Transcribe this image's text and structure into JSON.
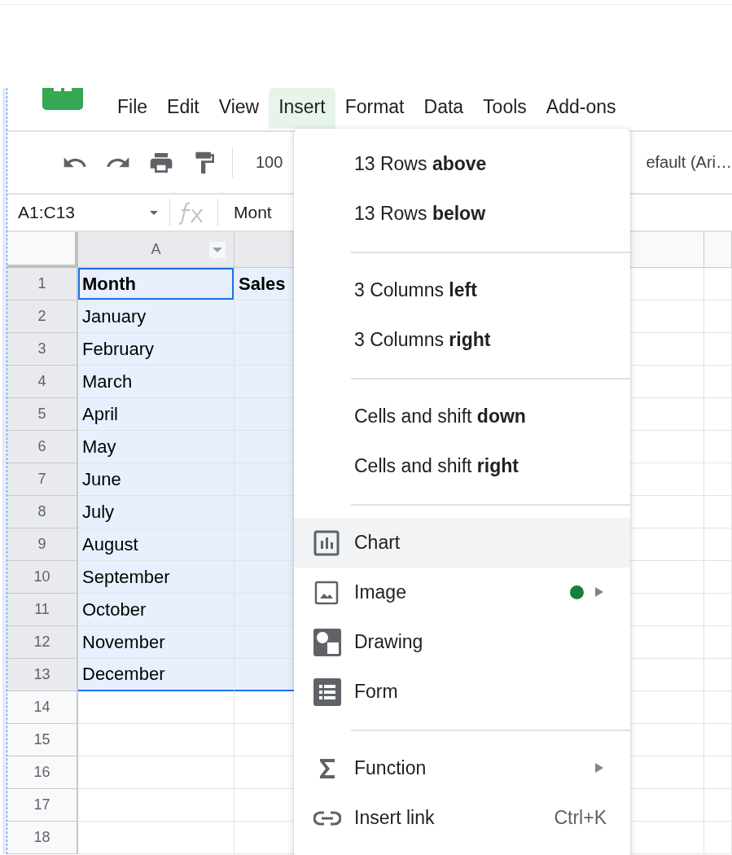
{
  "menu_bar": [
    {
      "label": "File",
      "selected": false
    },
    {
      "label": "Edit",
      "selected": false
    },
    {
      "label": "View",
      "selected": false
    },
    {
      "label": "Insert",
      "selected": true
    },
    {
      "label": "Format",
      "selected": false
    },
    {
      "label": "Data",
      "selected": false
    },
    {
      "label": "Tools",
      "selected": false
    },
    {
      "label": "Add-ons",
      "selected": false
    }
  ],
  "toolbar": {
    "zoom": "100",
    "font": "efault (Ari…"
  },
  "formula_bar": {
    "name_box": "A1:C13",
    "value": "Mont"
  },
  "column_header": "A",
  "rows": [
    {
      "number": "1",
      "selected": true,
      "bold": true,
      "cells": [
        "Month",
        "Sales"
      ]
    },
    {
      "number": "2",
      "selected": true,
      "bold": false,
      "cells": [
        "January"
      ]
    },
    {
      "number": "3",
      "selected": true,
      "bold": false,
      "cells": [
        "February"
      ]
    },
    {
      "number": "4",
      "selected": true,
      "bold": false,
      "cells": [
        "March"
      ]
    },
    {
      "number": "5",
      "selected": true,
      "bold": false,
      "cells": [
        "April"
      ]
    },
    {
      "number": "6",
      "selected": true,
      "bold": false,
      "cells": [
        "May"
      ]
    },
    {
      "number": "7",
      "selected": true,
      "bold": false,
      "cells": [
        "June"
      ]
    },
    {
      "number": "8",
      "selected": true,
      "bold": false,
      "cells": [
        "July"
      ]
    },
    {
      "number": "9",
      "selected": true,
      "bold": false,
      "cells": [
        "August"
      ]
    },
    {
      "number": "10",
      "selected": true,
      "bold": false,
      "cells": [
        "September"
      ]
    },
    {
      "number": "11",
      "selected": true,
      "bold": false,
      "cells": [
        "October"
      ]
    },
    {
      "number": "12",
      "selected": true,
      "bold": false,
      "cells": [
        "November"
      ]
    },
    {
      "number": "13",
      "selected": true,
      "bold": false,
      "cells": [
        "December"
      ]
    },
    {
      "number": "14",
      "selected": false,
      "cells": []
    },
    {
      "number": "15",
      "selected": false,
      "cells": []
    },
    {
      "number": "16",
      "selected": false,
      "cells": []
    },
    {
      "number": "17",
      "selected": false,
      "cells": []
    },
    {
      "number": "18",
      "selected": false,
      "cells": []
    }
  ],
  "insert_menu": [
    {
      "kind": "item",
      "label": "13 Rows **above**",
      "selected": false
    },
    {
      "kind": "item",
      "label": "13 Rows **below**",
      "selected": false
    },
    {
      "kind": "separator"
    },
    {
      "kind": "item",
      "label": "3 Columns **left**",
      "selected": false
    },
    {
      "kind": "item",
      "label": "3 Columns **right**",
      "selected": false
    },
    {
      "kind": "separator"
    },
    {
      "kind": "item",
      "label": "Cells and shift **down**",
      "selected": false
    },
    {
      "kind": "item",
      "label": "Cells and shift **right**",
      "selected": false
    },
    {
      "kind": "separator"
    },
    {
      "kind": "chart",
      "label": "Chart",
      "selected": true
    },
    {
      "kind": "image",
      "label": "Image",
      "selected": false,
      "new_dot": true,
      "submenu": true
    },
    {
      "kind": "drawing",
      "label": "Drawing",
      "selected": false
    },
    {
      "kind": "form",
      "label": "Form",
      "selected": false
    },
    {
      "kind": "separator"
    },
    {
      "kind": "function",
      "label": "Function",
      "selected": false,
      "submenu": true
    },
    {
      "kind": "link",
      "label": "Insert link",
      "selected": false,
      "shortcut": "Ctrl+K"
    }
  ]
}
